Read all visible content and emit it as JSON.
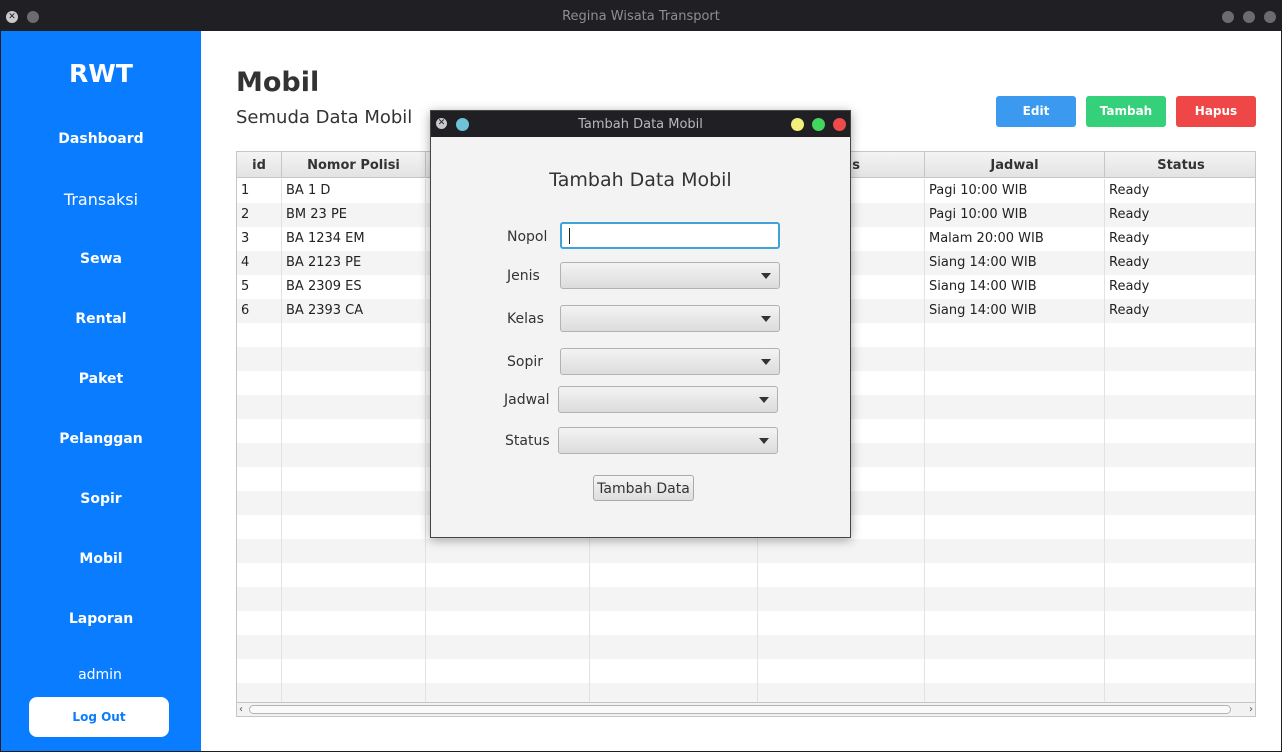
{
  "window": {
    "title": "Regina Wisata Transport"
  },
  "sidebar": {
    "brand": "RWT",
    "items": [
      {
        "label": "Dashboard"
      },
      {
        "label": "Transaksi"
      },
      {
        "label": "Sewa"
      },
      {
        "label": "Rental"
      },
      {
        "label": "Paket"
      },
      {
        "label": "Pelanggan"
      },
      {
        "label": "Sopir"
      },
      {
        "label": "Mobil"
      },
      {
        "label": "Laporan"
      }
    ],
    "user": "admin",
    "logout_label": "Log Out"
  },
  "main": {
    "title": "Mobil",
    "subtitle": "Semuda Data Mobil",
    "buttons": {
      "edit": "Edit",
      "add": "Tambah",
      "delete": "Hapus"
    }
  },
  "table": {
    "columns": [
      "id",
      "Nomor Polisi",
      "",
      "",
      "s",
      "Jadwal",
      "Status"
    ],
    "rows": [
      {
        "id": "1",
        "nopol": "BA 1 D",
        "jadwal": "Pagi 10:00 WIB",
        "status": "Ready"
      },
      {
        "id": "2",
        "nopol": "BM 23 PE",
        "jadwal": "Pagi 10:00 WIB",
        "status": "Ready"
      },
      {
        "id": "3",
        "nopol": "BA 1234 EM",
        "jadwal": "Malam 20:00 WIB",
        "status": "Ready"
      },
      {
        "id": "4",
        "nopol": "BA 2123 PE",
        "jadwal": "Siang 14:00 WIB",
        "status": "Ready"
      },
      {
        "id": "5",
        "nopol": "BA 2309 ES",
        "jadwal": "Siang 14:00 WIB",
        "status": "Ready"
      },
      {
        "id": "6",
        "nopol": "BA 2393 CA",
        "jadwal": "Siang 14:00 WIB",
        "status": "Ready"
      }
    ]
  },
  "dialog": {
    "window_title": "Tambah Data Mobil",
    "heading": "Tambah Data Mobil",
    "fields": {
      "nopol": {
        "label": "Nopol",
        "value": ""
      },
      "jenis": {
        "label": "Jenis",
        "value": ""
      },
      "kelas": {
        "label": "Kelas",
        "value": ""
      },
      "sopir": {
        "label": "Sopir",
        "value": ""
      },
      "jadwal": {
        "label": "Jadwal",
        "value": ""
      },
      "status": {
        "label": "Status",
        "value": ""
      }
    },
    "submit_label": "Tambah Data"
  }
}
